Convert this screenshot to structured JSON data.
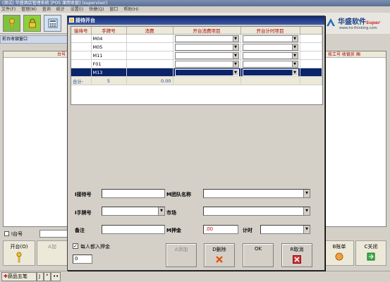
{
  "window": {
    "title": "(测试) 华盛酒店管理系统 [POS 溧用收银] (supervisor)",
    "menu": [
      "文件(F)",
      "管理(M)",
      "查询",
      "统计",
      "设置(I)",
      "快捷(Q)",
      "窗口",
      "帮助(H)"
    ]
  },
  "brand": {
    "name": "华盛软件",
    "suffix": "Super",
    "url": "www.hs-thinking.com"
  },
  "background": {
    "tab_label": "前台收银窗口",
    "left_col_header": "台号",
    "right_col_header": "技工号 收银员 厢",
    "table_no_label": "I台号",
    "buttons": {
      "open": "开台(O)",
      "add": "A加",
      "bill": "B账单",
      "close": "C关闭"
    },
    "status": {
      "item1": "获品五笔",
      "item2": "J",
      "item3": "°",
      "item4": "••"
    }
  },
  "dialog": {
    "title": "接待开台",
    "grid": {
      "columns": [
        "接待号",
        "手牌号",
        "消费",
        "开台消费项目",
        "开台计时项目"
      ],
      "rows": [
        {
          "reception": "",
          "card": "M04",
          "amount": ""
        },
        {
          "reception": "",
          "card": "M05",
          "amount": ""
        },
        {
          "reception": "",
          "card": "M11",
          "amount": ""
        },
        {
          "reception": "",
          "card": "F01",
          "amount": ""
        },
        {
          "reception": "",
          "card": "M13",
          "amount": ""
        }
      ],
      "selected_row": 4,
      "total": {
        "label": "合计:",
        "count": "5",
        "amount": "0.00"
      }
    },
    "form": {
      "reception_label": "I接待号",
      "reception_value": "",
      "group_label": "M团队名称",
      "group_value": "",
      "card_label": "I手牌号",
      "card_value": "",
      "market_label": "市场",
      "market_value": "",
      "remark_label": "备注",
      "remark_value": "",
      "deposit_label": "M押金",
      "deposit_value": ".00",
      "timing_label": "计时",
      "timing_value": "",
      "all_deposit_label": "每人都入押金",
      "all_deposit_checked": true,
      "count_value": "0"
    },
    "buttons": {
      "add": "A添加",
      "delete": "D删除",
      "ok": "OK",
      "cancel": "R取消"
    }
  },
  "colors": {
    "selected_row": "#0a246a",
    "header_text": "#aa0000",
    "total_text": "#1d4fa0",
    "deposit_text": "#cc0000"
  }
}
